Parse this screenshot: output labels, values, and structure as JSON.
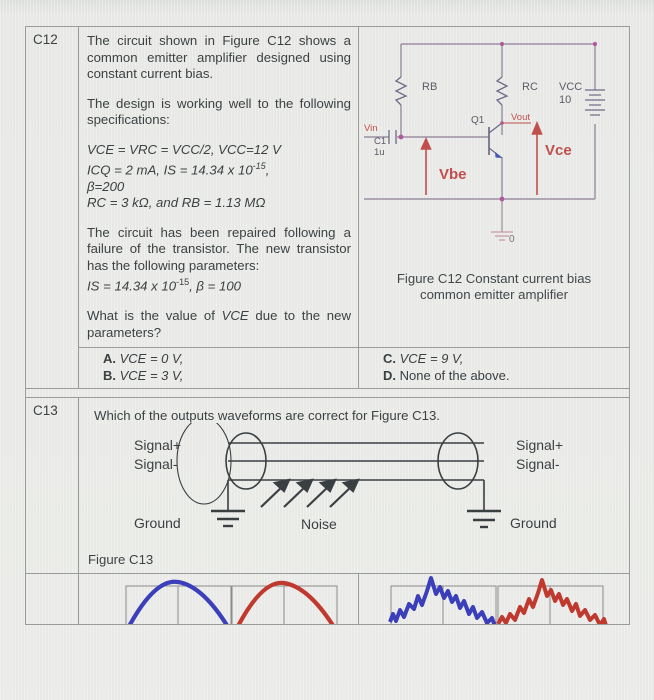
{
  "document": {
    "type": "exam-question-sheet"
  },
  "q12": {
    "id": "C12",
    "paragraphs": [
      "The circuit shown in Figure C12 shows a common emitter amplifier designed using constant current bias.",
      "The design is working well to the following specifications:"
    ],
    "specs": [
      "VCE = VRC = VCC/2, VCC=12 V",
      "ICQ = 2 mA, IS = 14.34 x 10",
      "β=200",
      "RC = 3 kΩ, and RB = 1.13 MΩ"
    ],
    "spec_exponent": "-15",
    "spec_exponent_tail": ",",
    "repair_text": "The circuit has been repaired following a failure of the transistor. The new transistor has the following parameters:",
    "new_params_prefix": "IS = 14.34 x 10",
    "new_params_exp": "-15",
    "new_params_tail": ", β = 100",
    "question": "What is the value of VCE due to the new parameters?",
    "question_pre": "What is the value of ",
    "question_italic": "VCE",
    "question_post": " due to the new parameters?",
    "answers": [
      {
        "key": "A.",
        "text": "VCE = 0 V,"
      },
      {
        "key": "B.",
        "text": "VCE = 3 V,"
      },
      {
        "key": "C.",
        "text": "VCE = 9 V,"
      },
      {
        "key": "D.",
        "text": "None of the above."
      }
    ],
    "figure": {
      "caption_line1": "Figure C12 Constant current bias",
      "caption_line2": "common emitter amplifier",
      "labels": {
        "rb": "RB",
        "rc": "RC",
        "vcc": "VCC",
        "vcc_value": "10",
        "q1": "Q1",
        "vout": "Vout",
        "vce": "Vce",
        "vbe": "Vbe",
        "vin": "Vin",
        "c1": "C1",
        "c1_value": "1u",
        "ground": "0"
      },
      "colors": {
        "wire": "#8b7f94",
        "annotation": "#c0504d",
        "node": "#b0589c",
        "device": "#6f6a86"
      }
    }
  },
  "q13": {
    "id": "C13",
    "question": "Which of the outputs waveforms are correct for Figure C13.",
    "figure": {
      "label": "Figure C13",
      "left_labels": [
        "Signal+",
        "Signal-"
      ],
      "right_labels": [
        "Signal+",
        "Signal-"
      ],
      "ground_left": "Ground",
      "ground_right": "Ground",
      "noise": "Noise"
    },
    "waveforms": {
      "colors": {
        "blue": "#3b3fba",
        "red": "#c0392f"
      },
      "panels": [
        {
          "name": "smooth-blue",
          "color_key": "blue",
          "shape": "smooth-arch"
        },
        {
          "name": "smooth-red",
          "color_key": "red",
          "shape": "smooth-arch"
        },
        {
          "name": "noisy-blue",
          "color_key": "blue",
          "shape": "noisy"
        },
        {
          "name": "noisy-red",
          "color_key": "red",
          "shape": "noisy"
        }
      ]
    }
  }
}
